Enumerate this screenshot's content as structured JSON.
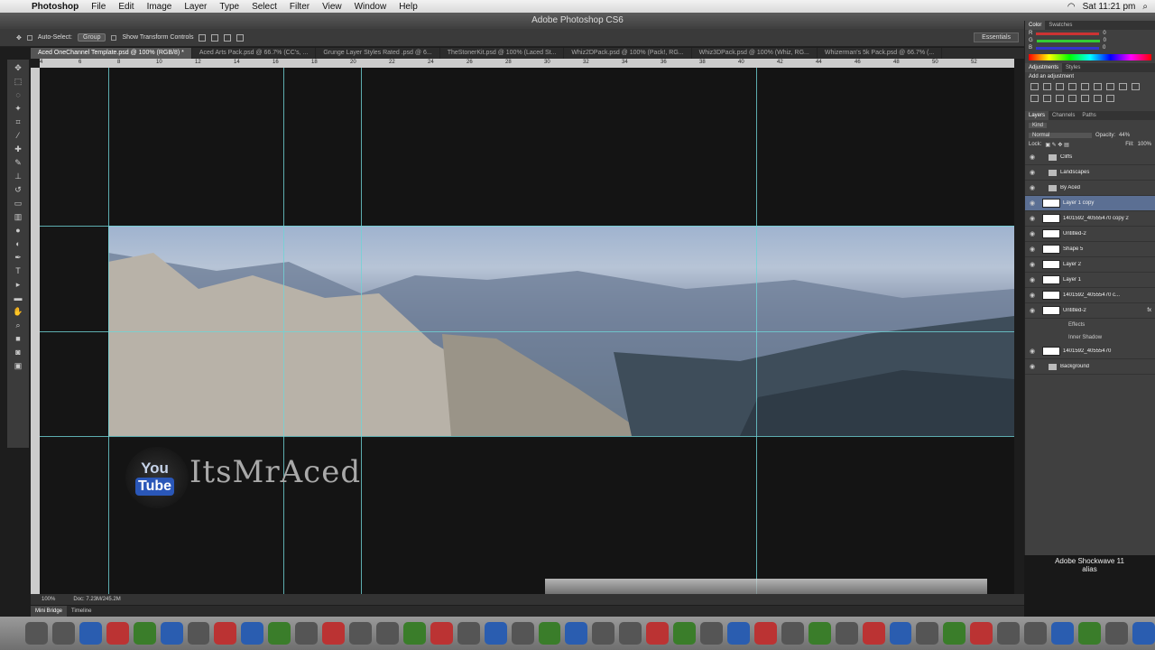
{
  "menubar": {
    "items": [
      "Photoshop",
      "File",
      "Edit",
      "Image",
      "Layer",
      "Type",
      "Select",
      "Filter",
      "View",
      "Window",
      "Help"
    ],
    "clock": "Sat 11:21 pm"
  },
  "window": {
    "title": "Adobe Photoshop CS6"
  },
  "options": {
    "auto_select": "Auto-Select:",
    "auto_select_value": "Group",
    "show_transform": "Show Transform Controls",
    "workspace": "Essentials"
  },
  "tabs": [
    "Aced OneChannel Template.psd @ 100% (RGB/8) *",
    "Aced Arts Pack.psd @ 66.7% (CC's, ...",
    "Grunge Layer Styles Rated .psd @ 6...",
    "TheStonerKit.psd @ 100% (Laced St...",
    "Whiz2DPack.psd @ 100% (Pack!, RG...",
    "Whiz3DPack.psd @ 100% (Whiz, RG...",
    "Whizerman's 5k Pack.psd @ 66.7% (..."
  ],
  "ruler_ticks": [
    "4",
    "6",
    "8",
    "10",
    "12",
    "14",
    "16",
    "18",
    "20",
    "22",
    "24",
    "26",
    "28",
    "30",
    "32",
    "34",
    "36",
    "38",
    "40",
    "42",
    "44",
    "46",
    "48",
    "50",
    "52"
  ],
  "canvas": {
    "brand_text": "ItsMrAced",
    "yt_you": "You",
    "yt_tube": "Tube"
  },
  "status": {
    "zoom": "100%",
    "doc": "Doc: 7.23M/245.2M"
  },
  "bottom_tabs": [
    "Mini Bridge",
    "Timeline"
  ],
  "panel": {
    "color_tabs": [
      "Color",
      "Swatches"
    ],
    "rgb": [
      {
        "label": "R",
        "value": "0"
      },
      {
        "label": "G",
        "value": "0"
      },
      {
        "label": "B",
        "value": "0"
      }
    ],
    "adj_tabs": [
      "Adjustments",
      "Styles"
    ],
    "adj_title": "Add an adjustment",
    "layer_tabs": [
      "Layers",
      "Channels",
      "Paths"
    ],
    "kind": "Kind",
    "blend": "Normal",
    "opacity_label": "Opacity:",
    "opacity": "44%",
    "lock_label": "Lock:",
    "fill_label": "Fill:",
    "fill": "100%",
    "layers": [
      {
        "name": "Cliffs",
        "type": "folder"
      },
      {
        "name": "Landscapes",
        "type": "folder"
      },
      {
        "name": "By Aced",
        "type": "folder"
      },
      {
        "name": "Layer 1 copy",
        "type": "layer",
        "selected": true
      },
      {
        "name": "1401592_40555470 copy 2",
        "type": "layer"
      },
      {
        "name": "Untitled-2",
        "type": "layer"
      },
      {
        "name": "Shape 5",
        "type": "layer"
      },
      {
        "name": "Layer 2",
        "type": "layer"
      },
      {
        "name": "Layer 1",
        "type": "layer"
      },
      {
        "name": "1401592_40555470 c...",
        "type": "layer"
      },
      {
        "name": "Untitled-2",
        "type": "layer",
        "fx": "fx"
      },
      {
        "name": "Effects",
        "type": "sub"
      },
      {
        "name": "Inner Shadow",
        "type": "sub"
      },
      {
        "name": "1401592_40555470",
        "type": "layer"
      },
      {
        "name": "Background",
        "type": "folder"
      }
    ]
  },
  "notice": {
    "line1": "Adobe Shockwave 11",
    "line2": "alias"
  }
}
